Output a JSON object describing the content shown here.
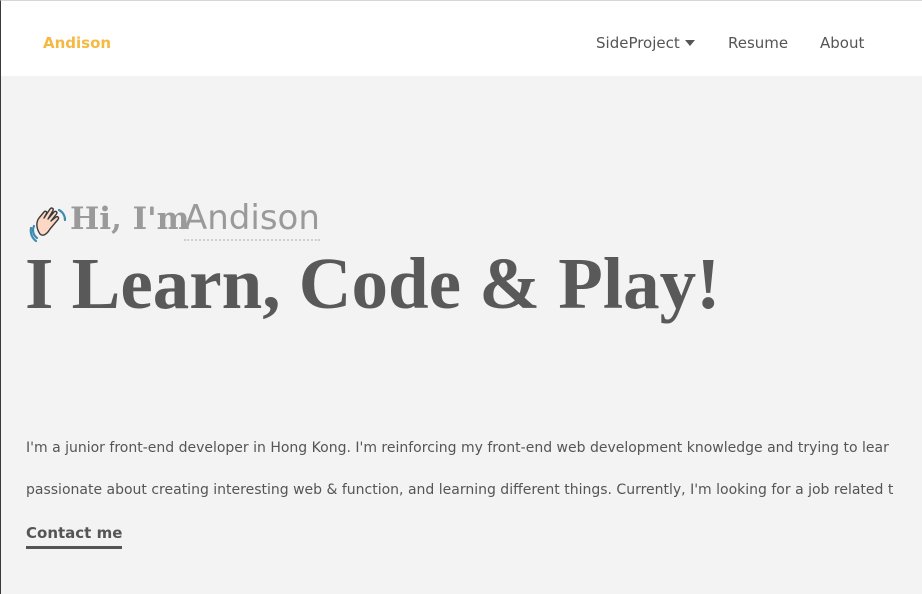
{
  "navbar": {
    "brand": "Andison",
    "items": [
      {
        "label": "SideProject",
        "has_dropdown": true
      },
      {
        "label": "Resume"
      },
      {
        "label": "About"
      }
    ]
  },
  "hero": {
    "greeting_prefix": "Hi, I'm",
    "greeting_name": "Andison",
    "headline": "I Learn, Code & Play!",
    "bio_line_1": "I'm a junior front-end developer in Hong Kong. I'm reinforcing my front-end web development knowledge and trying to lear",
    "bio_line_2": "passionate about creating interesting web & function, and learning different things. Currently, I'm looking for a job related t",
    "contact_label": "Contact me"
  },
  "icons": {
    "greeting": "waving-hand-icon",
    "dropdown": "caret-down-icon"
  },
  "colors": {
    "brand": "#f5b942",
    "text": "#555555",
    "headline": "#595959",
    "greeting": "#9a9a9a",
    "main_bg": "#f3f3f3",
    "navbar_bg": "#ffffff"
  }
}
